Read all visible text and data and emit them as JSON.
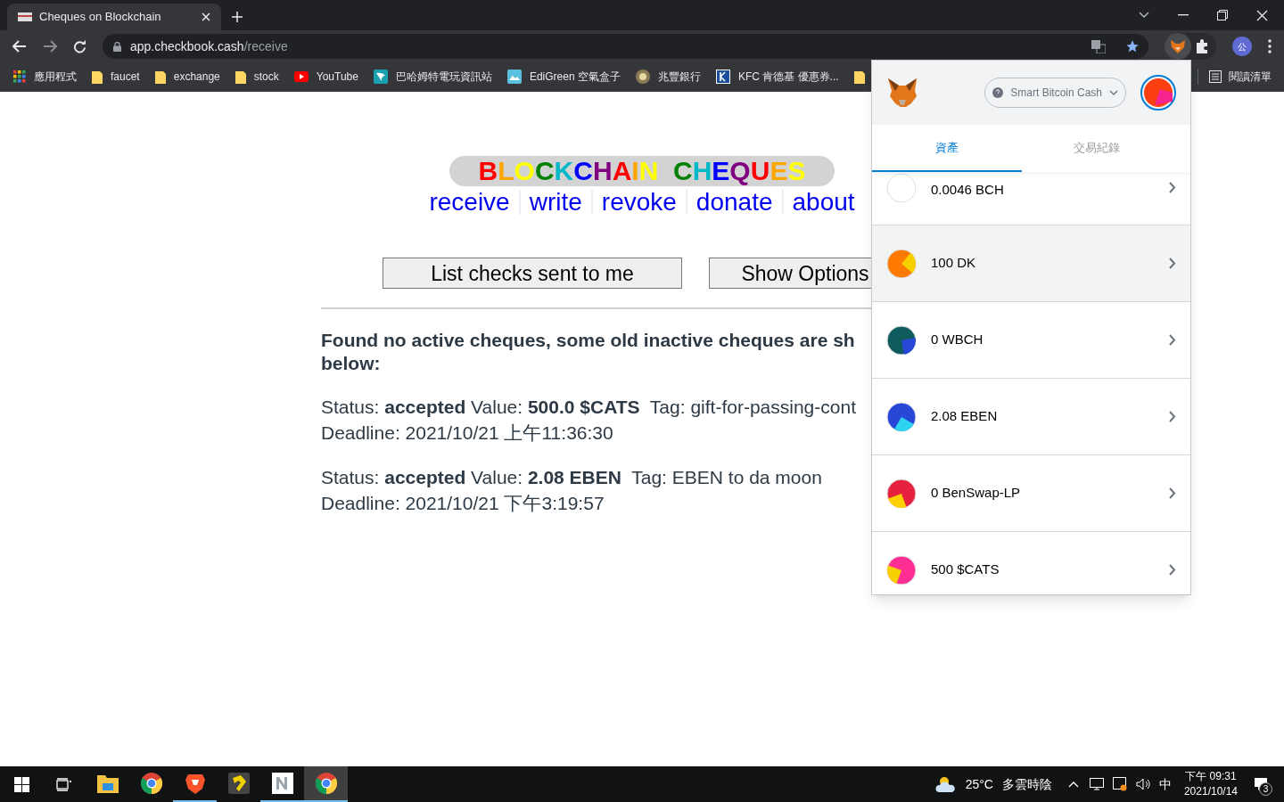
{
  "browser": {
    "tab_title": "Cheques on Blockchain",
    "url_host": "app.checkbook.cash",
    "url_path": "/receive",
    "profile": "公",
    "reading_list": "閱讀清單",
    "bookmarks": [
      {
        "kind": "apps",
        "label": "應用程式"
      },
      {
        "kind": "folder",
        "label": "faucet"
      },
      {
        "kind": "folder",
        "label": "exchange"
      },
      {
        "kind": "folder",
        "label": "stock"
      },
      {
        "kind": "video",
        "label": "YouTube"
      },
      {
        "kind": "fish",
        "label": "巴哈姆特電玩資訊站"
      },
      {
        "kind": "photo",
        "label": "EdiGreen 空氣盒子"
      },
      {
        "kind": "coin",
        "label": "兆豐銀行"
      },
      {
        "kind": "letter",
        "label": "KFC 肯德基 優惠券..."
      },
      {
        "kind": "folder"
      }
    ]
  },
  "page": {
    "logo": "BLOCKCHAIN  CHEQUES",
    "nav": [
      "receive",
      "write",
      "revoke",
      "donate",
      "about"
    ],
    "buttons": [
      "List checks sent to me",
      "Show Options"
    ],
    "heading_lines": [
      "Found no active cheques, some old inactive cheques are sh",
      "below:"
    ],
    "cheques": [
      {
        "line1": "Status: **accepted** Value: **500.0 $CATS**  Tag: gift-for-passing-cont",
        "line2": "Deadline: 2021/10/21 上午11:36:30"
      },
      {
        "line1": "Status: **accepted** Value: **2.08 EBEN**  Tag: EBEN to da moon",
        "line2": "Deadline: 2021/10/21 下午3:19:57"
      }
    ]
  },
  "wallet": {
    "network": "Smart Bitcoin Cash",
    "tabs": [
      {
        "label": "資產",
        "selected": true
      },
      {
        "label": "交易紀錄",
        "selected": false
      }
    ],
    "assets": [
      {
        "amount": "0.0046 BCH",
        "color": "#ffffff",
        "highlighted": false
      },
      {
        "amount": "100 DK",
        "color": "#ff7a00",
        "highlighted": true
      },
      {
        "amount": "0 WBCH",
        "color": "#0e5b5e",
        "highlighted": false
      },
      {
        "amount": "2.08 EBEN",
        "color": "#2747d6",
        "highlighted": false
      },
      {
        "amount": "0 BenSwap-LP",
        "color": "#e5213e",
        "highlighted": false
      },
      {
        "amount": "500 $CATS",
        "color": "#ff2e93",
        "highlighted": false
      }
    ]
  },
  "taskbar": {
    "apps": [
      {
        "kind": "folder",
        "running": false,
        "active": false
      },
      {
        "kind": "chrome",
        "running": false,
        "active": false
      },
      {
        "kind": "lion",
        "running": true,
        "active": false
      },
      {
        "kind": "yellow",
        "running": false,
        "active": false
      },
      {
        "kind": "n",
        "running": true,
        "active": false
      },
      {
        "kind": "chrome",
        "running": true,
        "active": true
      }
    ],
    "temperature": "25°C",
    "weather": "多雲時陰",
    "ime": "中",
    "time": "下午 09:31",
    "date": "2021/10/14",
    "notifications": "3"
  }
}
